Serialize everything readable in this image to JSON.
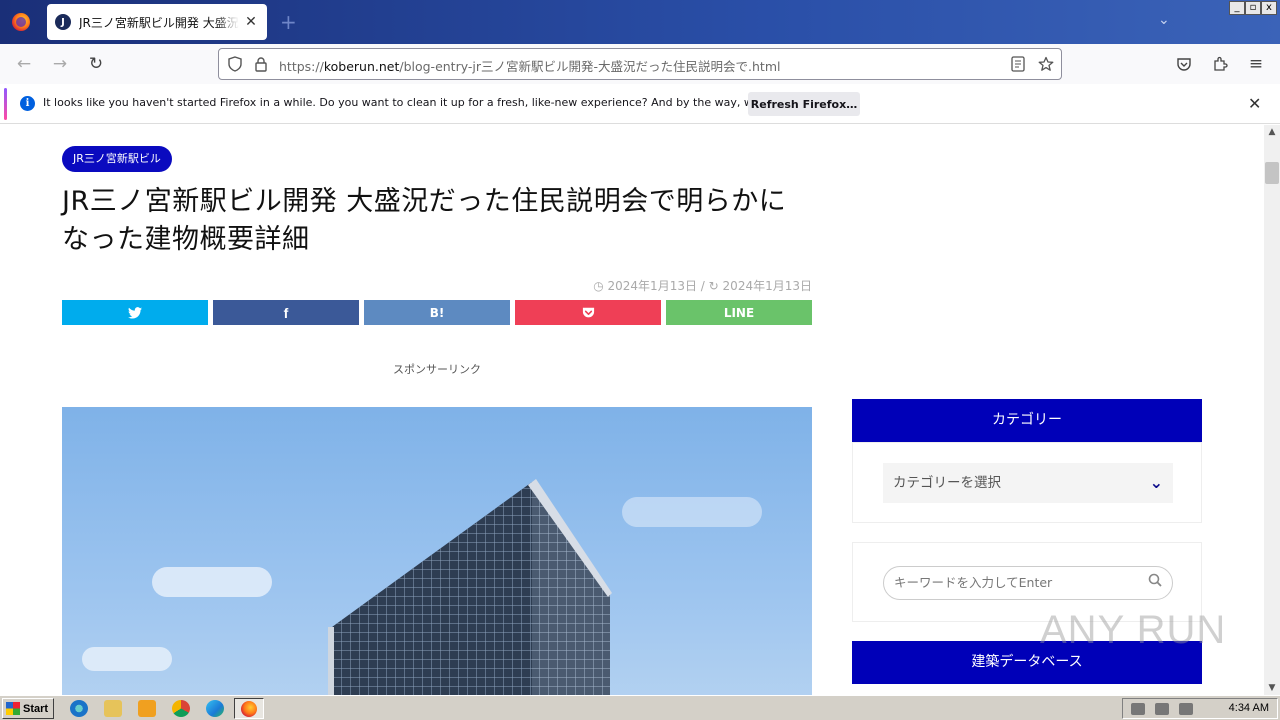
{
  "browser": {
    "tab_title": "JR三ノ宮新駅ビル開発 大盛況だった住民説明会で明らかになった建物概要詳細",
    "tab_favicon": "J",
    "url_prefix": "https://",
    "url_host": "koberun.net",
    "url_path": "/blog-entry-jr三ノ宮新駅ビル開発-大盛況だった住民説明会で.html",
    "notification_text": "It looks like you haven't started Firefox in a while. Do you want to clean it up for a fresh, like-new experience? And by the way, welcome back!",
    "refresh_label": "Refresh Firefox…",
    "window_controls": [
      "_",
      "▫",
      "x"
    ]
  },
  "article": {
    "category_badge": "JR三ノ宮新駅ビル",
    "title": "JR三ノ宮新駅ビル開発 大盛況だった住民説明会で明らかになった建物概要詳細",
    "published": "2024年1月13日",
    "updated": "2024年1月13日",
    "sponsor_label": "スポンサーリンク",
    "share_buttons": [
      {
        "label": "",
        "icon": "twitter-icon",
        "color": "#00aced"
      },
      {
        "label": "",
        "icon": "facebook-icon",
        "color": "#3b5998"
      },
      {
        "label": "B!",
        "icon": "hatena-icon",
        "color": "#5d8ac1"
      },
      {
        "label": "",
        "icon": "pocket-icon",
        "color": "#ef3f56"
      },
      {
        "label": "LINE",
        "icon": "line-icon",
        "color": "#6ac36a"
      }
    ]
  },
  "sidebar": {
    "category_heading": "カテゴリー",
    "category_select_placeholder": "カテゴリーを選択",
    "search_placeholder": "キーワードを入力してEnter",
    "database_heading": "建築データベース"
  },
  "watermark": "ANY RUN",
  "taskbar": {
    "start_label": "Start",
    "clock": "4:34 AM"
  },
  "colors": {
    "accent": "#0a0abf",
    "widget_header": "#0000b8"
  }
}
